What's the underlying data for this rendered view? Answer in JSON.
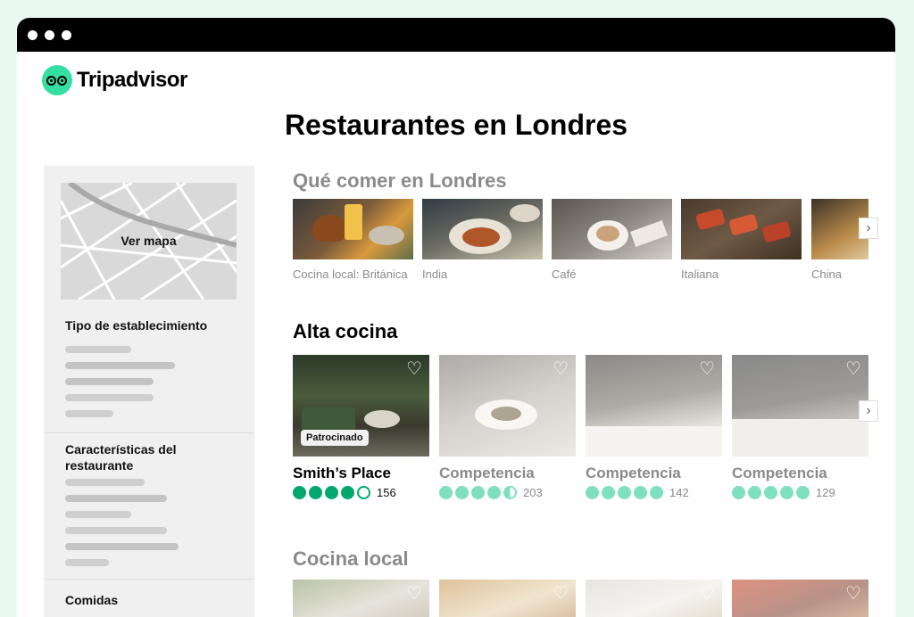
{
  "app": {
    "logo_text": "Tripadvisor"
  },
  "page_title": "Restaurantes en Londres",
  "sidebar": {
    "map_label": "Ver mapa",
    "sections": [
      {
        "title": "Tipo de establecimiento"
      },
      {
        "title": "Características del restaurante"
      },
      {
        "title": "Comidas"
      }
    ]
  },
  "what_to_eat": {
    "title": "Qué comer en Londres",
    "categories": [
      {
        "label": "Cocina local: Británica"
      },
      {
        "label": "India"
      },
      {
        "label": "Café"
      },
      {
        "label": "Italiana"
      },
      {
        "label": "China"
      }
    ]
  },
  "fine_dining": {
    "title": "Alta cocina",
    "cards": [
      {
        "name": "Smith’s Place",
        "rating": 4,
        "reviews": "156",
        "badge": "Patrocinado"
      },
      {
        "name": "Competencia",
        "rating": 4.5,
        "reviews": "203"
      },
      {
        "name": "Competencia",
        "rating": 5,
        "reviews": "142"
      },
      {
        "name": "Competencia",
        "rating": 5,
        "reviews": "129"
      }
    ]
  },
  "local_cuisine": {
    "title": "Cocina local"
  },
  "icons": {
    "heart": "heart-icon",
    "next": "chevron-right-icon"
  },
  "colors": {
    "brand": "#34e0a1",
    "rating": "#00aa6c"
  }
}
